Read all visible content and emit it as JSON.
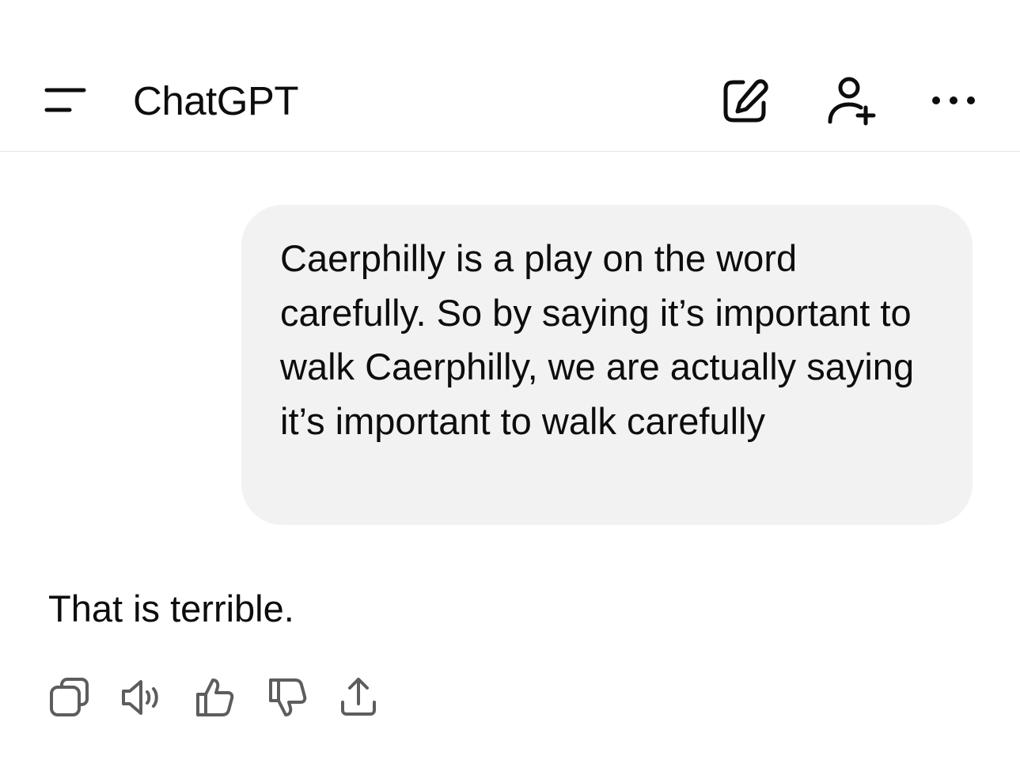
{
  "header": {
    "title": "ChatGPT",
    "icons": {
      "menu": "menu-icon",
      "new_chat": "edit-icon",
      "add_people": "add-person-icon",
      "more": "more-horizontal-icon"
    }
  },
  "conversation": {
    "user_message": "Caerphilly is a play on the word carefully. So by saying it’s important to walk Caerphilly, we are actually saying it’s important to walk carefully",
    "assistant_message": "That is terrible."
  },
  "message_actions": {
    "icons": [
      "copy-icon",
      "read-aloud-icon",
      "thumbs-up-icon",
      "thumbs-down-icon",
      "share-icon"
    ]
  },
  "colors": {
    "text": "#0d0d0d",
    "bubble": "#f2f2f2",
    "divider": "#e5e5e5",
    "icon": "#0d0d0d",
    "action_icon": "#5d5d5d"
  }
}
